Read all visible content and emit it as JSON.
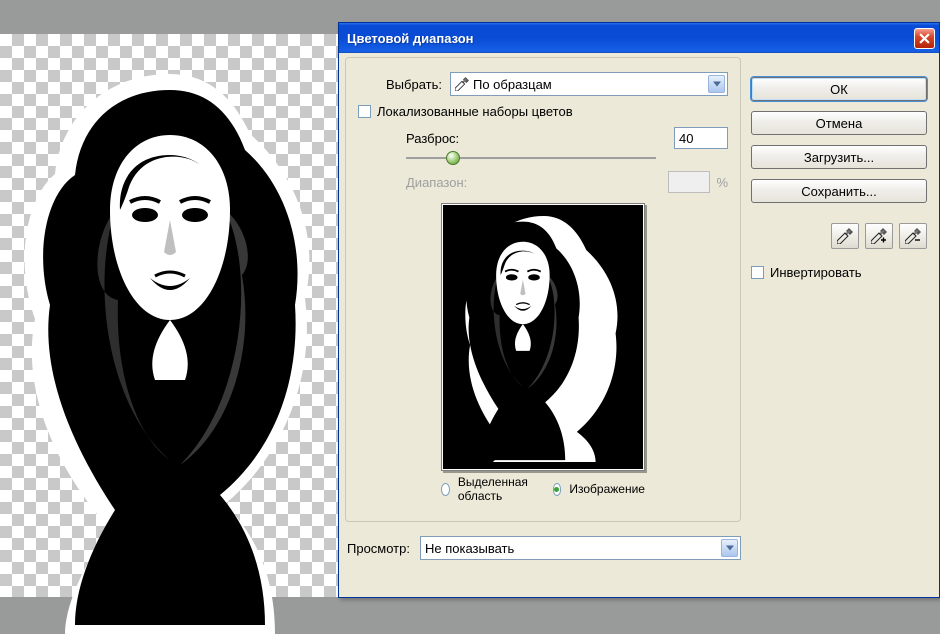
{
  "dialog": {
    "title": "Цветовой диапазон",
    "select_label": "Выбрать:",
    "select_value": "По образцам",
    "localized_label": "Локализованные наборы цветов",
    "fuzziness_label": "Разброс:",
    "fuzziness_value": "40",
    "range_label": "Диапазон:",
    "range_unit": "%",
    "radio_selection": "Выделенная область",
    "radio_image": "Изображение",
    "preview_label": "Просмотр:",
    "preview_value": "Не показывать"
  },
  "buttons": {
    "ok": "ОК",
    "cancel": "Отмена",
    "load": "Загрузить...",
    "save": "Сохранить..."
  },
  "invert_label": "Инвертировать",
  "slider": {
    "pos_pct": 16
  }
}
